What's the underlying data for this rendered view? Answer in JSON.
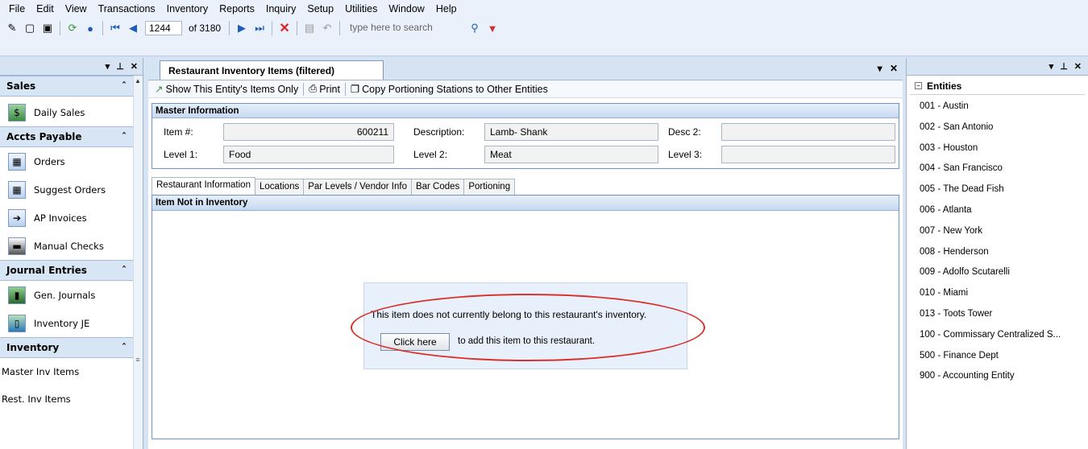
{
  "menu": [
    "File",
    "Edit",
    "View",
    "Transactions",
    "Inventory",
    "Reports",
    "Inquiry",
    "Setup",
    "Utilities",
    "Window",
    "Help"
  ],
  "toolbar": {
    "record_number": "1244",
    "record_total": "of 3180",
    "search_placeholder": "type here to search"
  },
  "sidebar": {
    "groups": {
      "sales": "Sales",
      "accts_payable": "Accts Payable",
      "journal_entries": "Journal Entries",
      "inventory": "Inventory"
    },
    "items": {
      "daily_sales": "Daily Sales",
      "orders": "Orders",
      "suggest_orders": "Suggest Orders",
      "ap_invoices": "AP Invoices",
      "manual_checks": "Manual Checks",
      "gen_journals": "Gen. Journals",
      "inventory_je": "Inventory JE",
      "master_inv_items": "Master Inv Items",
      "rest_inv_items": "Rest. Inv Items"
    }
  },
  "document": {
    "tab_title": "Restaurant Inventory Items (filtered)",
    "commands": {
      "show_entity": "Show This Entity's Items Only",
      "print": "Print",
      "copy_stations": "Copy Portioning Stations to Other Entities"
    },
    "master": {
      "header": "Master Information",
      "item_label": "Item #:",
      "item_value": "600211",
      "description_label": "Description:",
      "description_value": "Lamb- Shank",
      "desc2_label": "Desc 2:",
      "desc2_value": "",
      "level1_label": "Level 1:",
      "level1_value": "Food",
      "level2_label": "Level 2:",
      "level2_value": "Meat",
      "level3_label": "Level 3:",
      "level3_value": ""
    },
    "tabs": [
      "Restaurant Information",
      "Locations",
      "Par Levels / Vendor Info",
      "Bar Codes",
      "Portioning"
    ],
    "panel_header": "Item Not in Inventory",
    "notice": {
      "message": "This item does not currently belong to this restaurant's inventory.",
      "button": "Click here",
      "button_note": "to add this item to this restaurant."
    }
  },
  "entities": {
    "header": "Entities",
    "items": [
      "001 - Austin",
      "002 - San Antonio",
      "003 - Houston",
      "004 - San Francisco",
      "005 - The Dead Fish",
      "006 - Atlanta",
      "007 - New York",
      "008 - Henderson",
      "009 - Adolfo Scutarelli",
      "010 - Miami",
      "013 - Toots Tower",
      "100 - Commissary Centralized S...",
      "500 - Finance Dept",
      "900 - Accounting Entity"
    ]
  },
  "colors": {
    "highlight_ring": "#d8322d",
    "panel_border": "#6f92c4"
  }
}
